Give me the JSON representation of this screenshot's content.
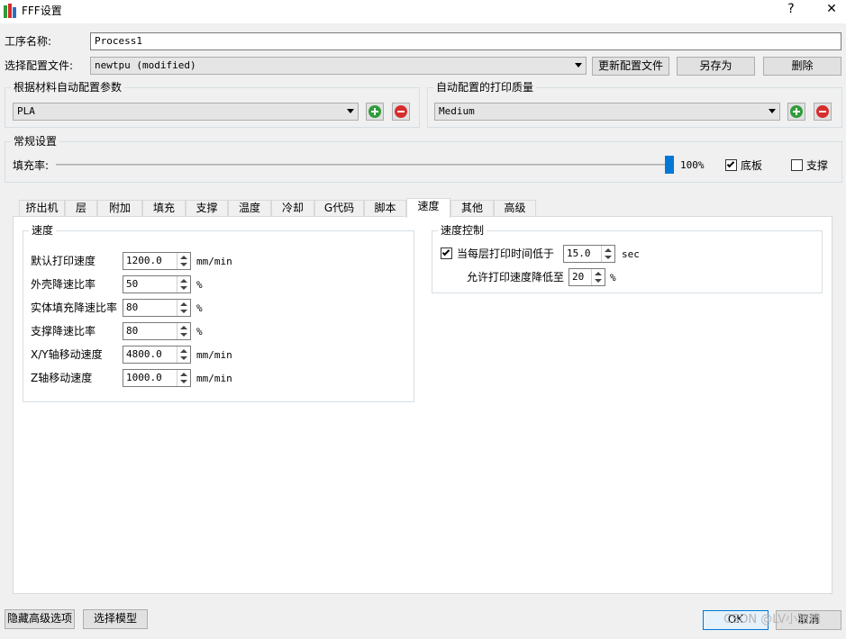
{
  "window": {
    "title": "FFF设置",
    "help_label": "?",
    "close_label": "✕",
    "icon": "app-bars-icon"
  },
  "profile": {
    "process_name_label": "工序名称:",
    "process_name_value": "Process1",
    "config_file_label": "选择配置文件:",
    "config_file_value": "newtpu (modified)",
    "update_button": "更新配置文件",
    "save_as_button": "另存为",
    "delete_button": "删除"
  },
  "material_group": {
    "title": "根据材料自动配置参数",
    "value": "PLA"
  },
  "quality_group": {
    "title": "自动配置的打印质量",
    "value": "Medium"
  },
  "general": {
    "title": "常规设置",
    "infill_label": "填充率:",
    "infill_percent": 100,
    "infill_text": "100%",
    "raft_label": "底板",
    "raft_checked": true,
    "support_label": "支撑",
    "support_checked": false
  },
  "tabs": [
    {
      "label": "挤出机"
    },
    {
      "label": "层"
    },
    {
      "label": "附加"
    },
    {
      "label": "填充"
    },
    {
      "label": "支撑"
    },
    {
      "label": "温度"
    },
    {
      "label": "冷却"
    },
    {
      "label": "G代码"
    },
    {
      "label": "脚本"
    },
    {
      "label": "速度",
      "active": true
    },
    {
      "label": "其他"
    },
    {
      "label": "高级"
    }
  ],
  "speed_group": {
    "title": "速度",
    "rows": [
      {
        "label": "默认打印速度",
        "value": "1200.0",
        "unit": "mm/min"
      },
      {
        "label": "外壳降速比率",
        "value": "50",
        "unit": "%"
      },
      {
        "label": "实体填充降速比率",
        "value": "80",
        "unit": "%"
      },
      {
        "label": "支撑降速比率",
        "value": "80",
        "unit": "%"
      },
      {
        "label": "X/Y轴移动速度",
        "value": "4800.0",
        "unit": "mm/min"
      },
      {
        "label": "Z轴移动速度",
        "value": "1000.0",
        "unit": "mm/min"
      }
    ]
  },
  "speed_control": {
    "title": "速度控制",
    "layer_time_label": "当每层打印时间低于",
    "layer_time_checked": true,
    "layer_time_value": "15.0",
    "layer_time_unit": "sec",
    "reduce_label": "允许打印速度降低至",
    "reduce_value": "20",
    "reduce_unit": "%"
  },
  "footer": {
    "hide_advanced_button": "隐藏高级选项",
    "select_model_button": "选择模型",
    "ok_button": "OK",
    "cancel_button": "取消"
  },
  "watermark": "CSDN @LV小猪精",
  "colors": {
    "accent": "#0078d7",
    "add": "#2e9c3a",
    "remove": "#d62d2d"
  }
}
